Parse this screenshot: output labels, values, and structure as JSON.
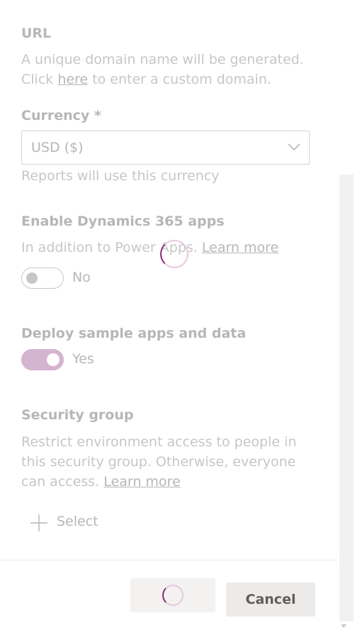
{
  "form": {
    "url": {
      "label": "URL",
      "desc_line1": "A unique domain name will be generated.",
      "desc_line2_prefix": "Click ",
      "desc_link": "here",
      "desc_line2_suffix": " to enter a custom domain."
    },
    "currency": {
      "label": "Currency *",
      "selected": "USD ($)",
      "hint": "Reports will use this currency"
    },
    "dynamics": {
      "label": "Enable Dynamics 365 apps",
      "desc": "In addition to Power Apps.",
      "link": "Learn more",
      "toggle_state": "No"
    },
    "sample": {
      "label": "Deploy sample apps and data",
      "toggle_state": "Yes"
    },
    "security": {
      "label": "Security group",
      "desc_line1": "Restrict environment access to people in",
      "desc_line2": "this security group. Otherwise, everyone",
      "desc_line3_prefix": "can access. ",
      "link": "Learn more",
      "select_label": "Select"
    }
  },
  "footer": {
    "cancel_label": "Cancel"
  },
  "icons": {
    "dropdown": "chevron-down-icon",
    "add": "plus-icon",
    "loading": "spinner-icon"
  },
  "colors": {
    "accent": "#8a2a78",
    "text": "#323130",
    "muted": "#605e5c"
  }
}
